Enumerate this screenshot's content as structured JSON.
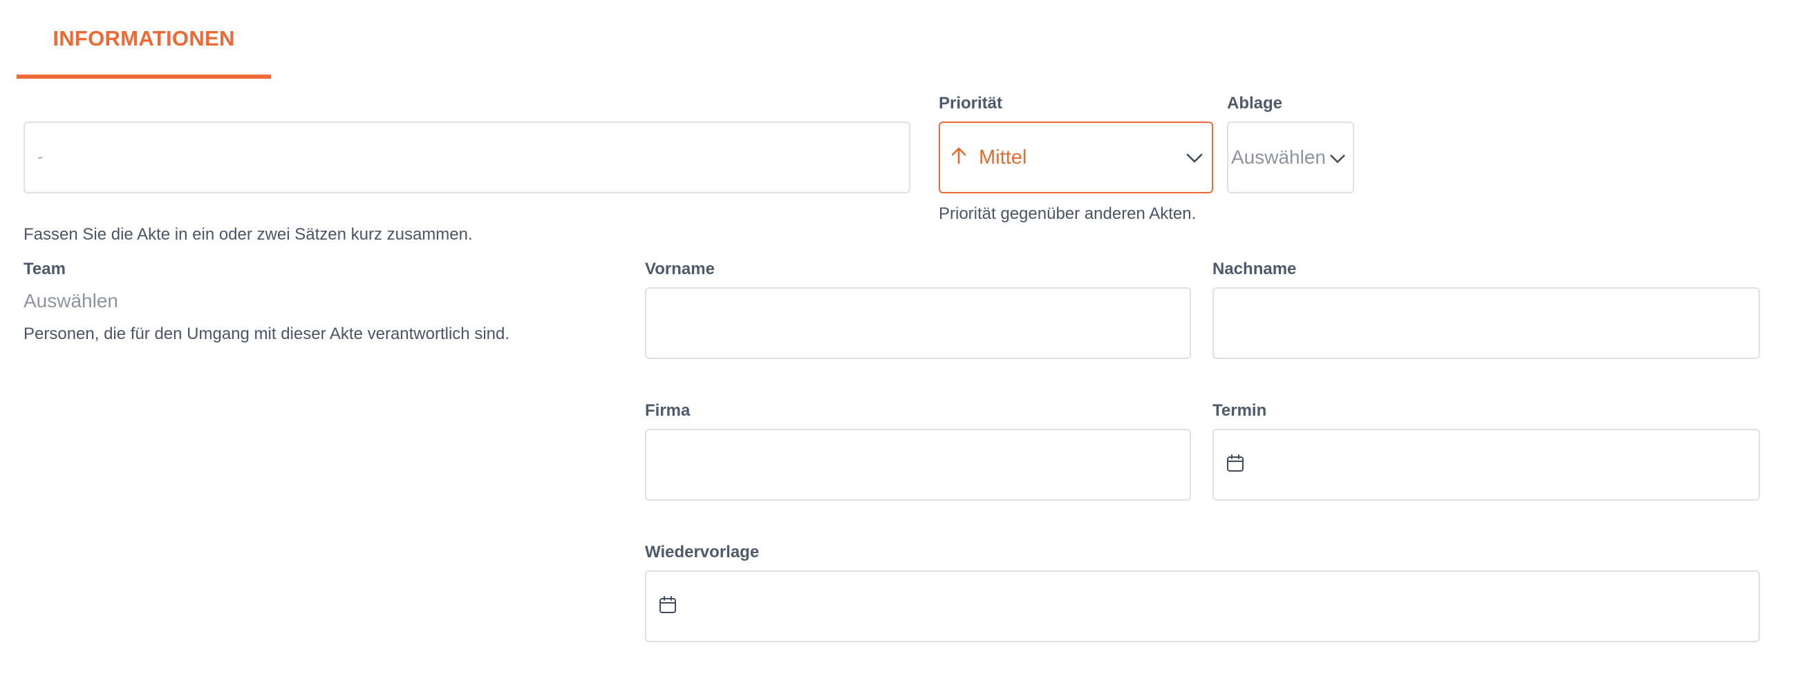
{
  "tabs": [
    {
      "label": "INFORMATIONEN",
      "active": true
    }
  ],
  "summary": {
    "value": "-",
    "help": "Fassen Sie die Akte in ein oder zwei Sätzen kurz zusammen."
  },
  "priority": {
    "label": "Priorität",
    "value": "Mittel",
    "help": "Priorität gegenüber anderen Akten.",
    "icon": "arrow-up-icon"
  },
  "ablage": {
    "label": "Ablage",
    "placeholder": "Auswählen"
  },
  "team": {
    "label": "Team",
    "placeholder": "Auswählen",
    "help": "Personen, die für den Umgang mit dieser Akte verantwortlich sind."
  },
  "vorname": {
    "label": "Vorname",
    "value": ""
  },
  "nachname": {
    "label": "Nachname",
    "value": ""
  },
  "firma": {
    "label": "Firma",
    "value": ""
  },
  "termin": {
    "label": "Termin",
    "value": "",
    "icon": "calendar-icon"
  },
  "wiedervorlage": {
    "label": "Wiedervorlage",
    "value": "",
    "icon": "calendar-icon"
  },
  "colors": {
    "accent": "#ec6a35",
    "border": "#dde1e7",
    "label": "#4d5a6b",
    "muted": "#8d94a0"
  }
}
